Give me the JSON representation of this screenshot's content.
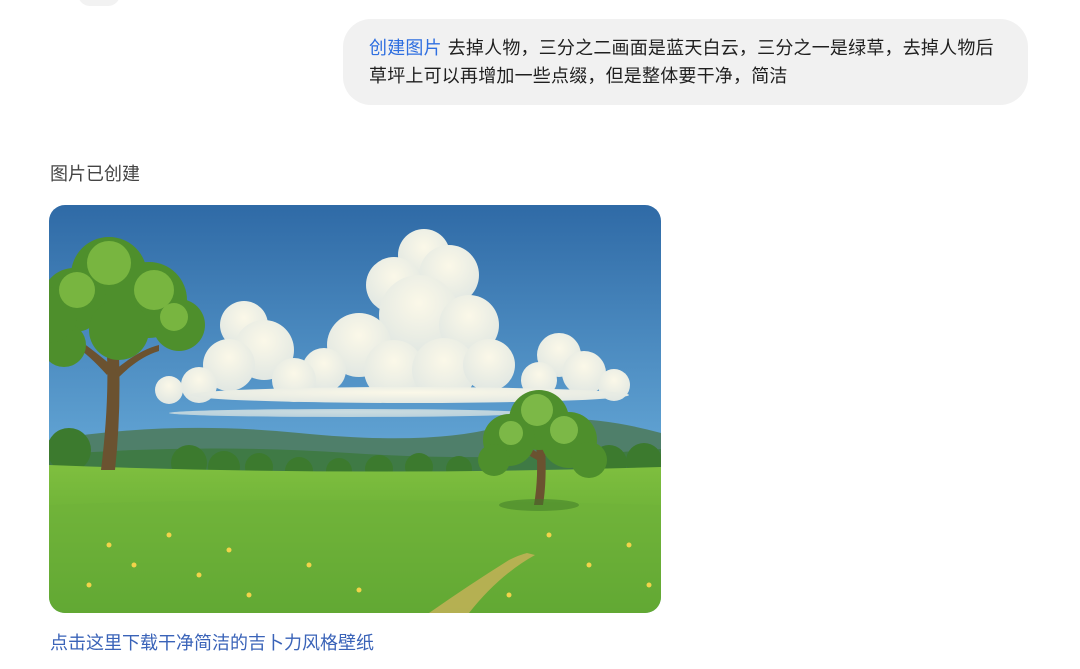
{
  "user_message": {
    "tag": "创建图片",
    "text": " 去掉人物，三分之二画面是蓝天白云，三分之一是绿草，去掉人物后草坪上可以再增加一些点缀，但是整体要干净，简洁"
  },
  "assistant": {
    "status": "图片已创建",
    "image_description_icon": "landscape-image",
    "download_link": "点击这里下载干净简洁的吉卜力风格壁纸"
  },
  "colors": {
    "tag_blue": "#2f6fe0",
    "link_blue": "#3a63b8",
    "bubble_bg": "#f1f1f1"
  }
}
